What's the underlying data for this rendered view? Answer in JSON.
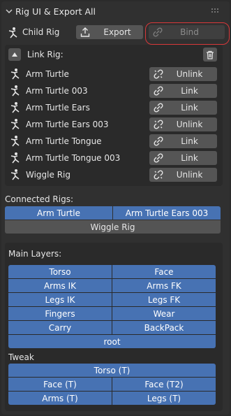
{
  "panel": {
    "title": "Rig UI & Export All"
  },
  "child_rig": {
    "label": "Child Rig",
    "export_label": "Export",
    "bind_label": "Bind"
  },
  "link_rig": {
    "label": "Link Rig:",
    "items": [
      {
        "name": "Arm Turtle",
        "action": "Unlink"
      },
      {
        "name": "Arm Turtle 003",
        "action": "Link"
      },
      {
        "name": "Arm Turtle Ears",
        "action": "Link"
      },
      {
        "name": "Arm Turtle Ears 003",
        "action": "Unlink"
      },
      {
        "name": "Arm Turtle Tongue",
        "action": "Link"
      },
      {
        "name": "Arm Turtle Tongue 003",
        "action": "Link"
      },
      {
        "name": "Wiggle Rig",
        "action": "Unlink"
      }
    ]
  },
  "connected_rigs": {
    "label": "Connected Rigs:",
    "items": [
      "Arm Turtle",
      "Arm Turtle Ears 003",
      "Wiggle Rig"
    ]
  },
  "main_layers": {
    "label": "Main Layers:",
    "items": [
      "Torso",
      "Face",
      "Arms IK",
      "Arms FK",
      "Legs IK",
      "Legs FK",
      "Fingers",
      "Wear",
      "Carry",
      "BackPack",
      "root"
    ]
  },
  "tweak": {
    "label": "Tweak",
    "items": [
      "Torso (T)",
      "Face (T)",
      "Face (T2)",
      "Arms (T)",
      "Legs (T)"
    ]
  },
  "colors": {
    "accent": "#4772b3",
    "highlight_ring": "#d8383a"
  }
}
